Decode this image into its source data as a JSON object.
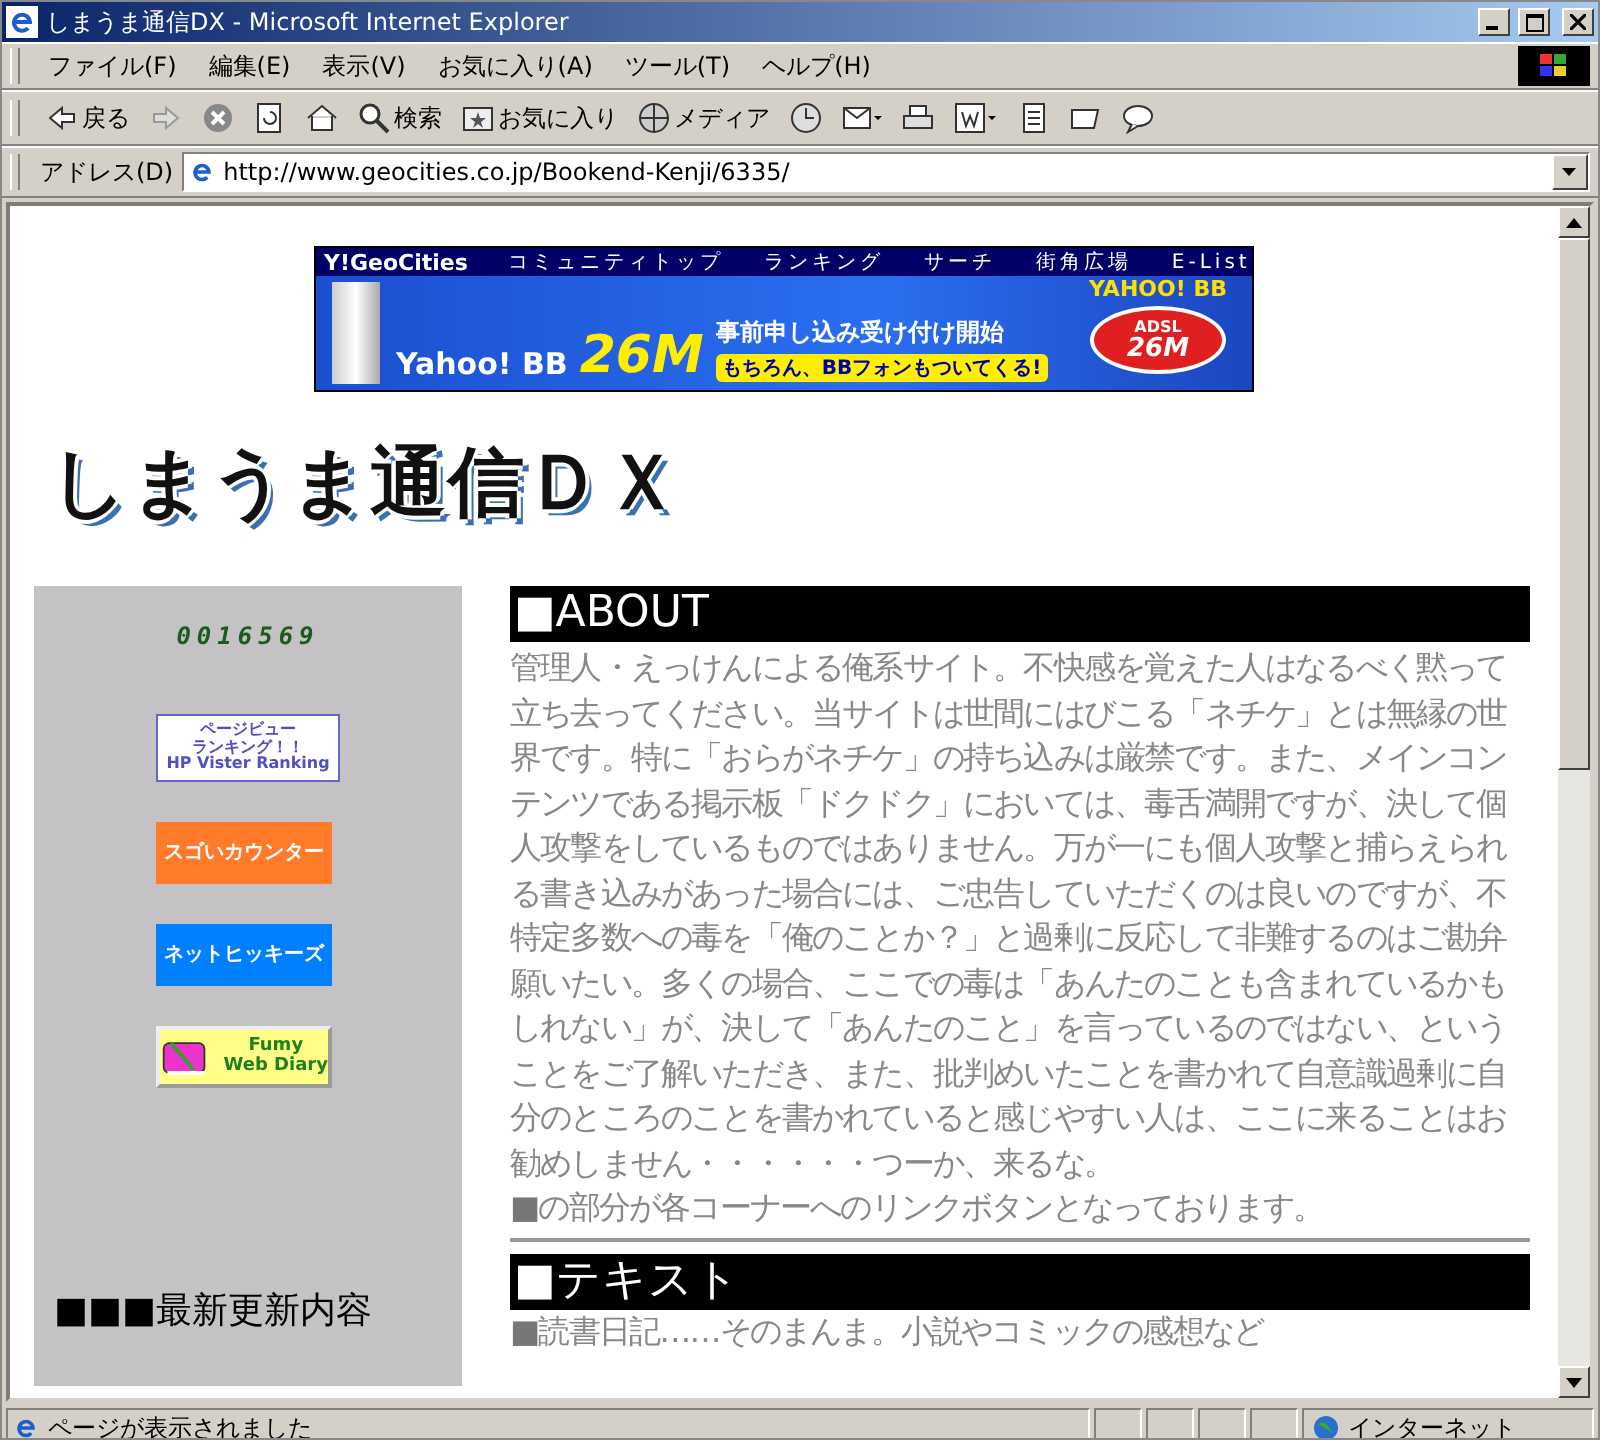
{
  "window": {
    "title": "しまうま通信DX - Microsoft Internet Explorer"
  },
  "menu": [
    "ファイル(F)",
    "編集(E)",
    "表示(V)",
    "お気に入り(A)",
    "ツール(T)",
    "ヘルプ(H)"
  ],
  "toolbar": [
    {
      "kind": "back",
      "label": "戻る"
    },
    {
      "kind": "forward"
    },
    {
      "kind": "stop"
    },
    {
      "kind": "refresh"
    },
    {
      "kind": "home"
    },
    {
      "kind": "search",
      "label": "検索"
    },
    {
      "kind": "favorites",
      "label": "お気に入り"
    },
    {
      "kind": "media",
      "label": "メディア"
    },
    {
      "kind": "history"
    },
    {
      "kind": "mail"
    },
    {
      "kind": "print"
    },
    {
      "kind": "edit"
    },
    {
      "kind": "discuss"
    },
    {
      "kind": "messenger"
    },
    {
      "kind": "chat"
    }
  ],
  "address": {
    "label": "アドレス(D)",
    "url": "http://www.geocities.co.jp/Bookend-Kenji/6335/"
  },
  "banner": {
    "brand": "Y!GeoCities",
    "nav": [
      "コミュニティトップ",
      "ランキング",
      "サーチ",
      "街角広場",
      "E-List"
    ],
    "ad": {
      "product": "Yahoo! BB",
      "speed": "26M",
      "headline": "事前申し込み受け付け開始",
      "subline": "もちろん、BBフォンもついてくる!",
      "logo": "YAHOO! BB",
      "badge_top": "ADSL",
      "badge_speed": "26M"
    }
  },
  "logo": "しまうま通信ＤＸ",
  "sidebar": {
    "counter": "0016569",
    "badges": [
      {
        "kind": "ranking",
        "lines": [
          "ページビュー",
          "ランキング！！",
          "HP Vister Ranking"
        ]
      },
      {
        "kind": "plain",
        "color": "#ff7b2a",
        "lines": [
          "スゴいカウンター"
        ]
      },
      {
        "kind": "plain",
        "color": "#0080ff",
        "lines": [
          "ネットヒッキーズ"
        ]
      },
      {
        "kind": "diary",
        "lines": [
          "Fumy",
          "Web Diary"
        ]
      }
    ],
    "heading": "■■■最新更新内容"
  },
  "sections": [
    {
      "title": "■ABOUT",
      "body": "管理人・えっけんによる俺系サイト。不快感を覚えた人はなるべく黙って立ち去ってください。当サイトは世間にはびこる「ネチケ」とは無縁の世界です。特に「おらがネチケ」の持ち込みは厳禁です。また、メインコンテンツである掲示板「ドクドク」においては、毒舌満開ですが、決して個人攻撃をしているものではありません。万が一にも個人攻撃と捕らえられる書き込みがあった場合には、ご忠告していただくのは良いのですが、不特定多数への毒を「俺のことか？」と過剰に反応して非難するのはご勘弁願いたい。多くの場合、ここでの毒は「あんたのことも含まれているかもしれない」が、決して「あんたのこと」を言っているのではない、ということをご了解いただき、また、批判めいたことを書かれて自意識過剰に自分のところのことを書かれていると感じやすい人は、ここに来ることはお勧めしません・・・・・・つーか、来るな。",
      "notes": [
        {
          "marker": "■",
          "text": "の部分が各コーナーへのリンクボタンとなっております。"
        }
      ]
    },
    {
      "title": "■テキスト",
      "notes": [
        {
          "marker": "■",
          "text": "読書日記……そのまんま。小説やコミックの感想など"
        }
      ]
    }
  ],
  "status": {
    "text": "ページが表示されました",
    "zone": "インターネット"
  }
}
